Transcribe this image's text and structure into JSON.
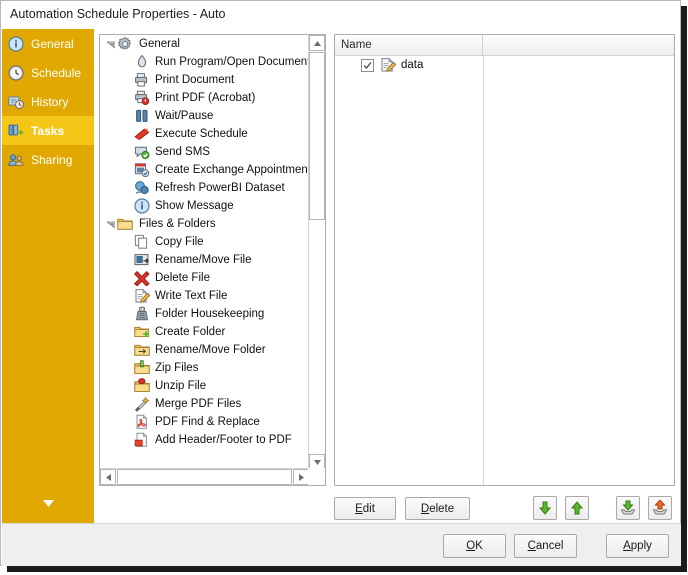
{
  "window": {
    "title": "Automation Schedule Properties - Auto"
  },
  "sidebar": {
    "items": [
      {
        "label": "General",
        "icon": "info-icon",
        "selected": false
      },
      {
        "label": "Schedule",
        "icon": "clock-icon",
        "selected": false
      },
      {
        "label": "History",
        "icon": "history-icon",
        "selected": false
      },
      {
        "label": "Tasks",
        "icon": "tasks-icon",
        "selected": true
      },
      {
        "label": "Sharing",
        "icon": "sharing-icon",
        "selected": false
      }
    ],
    "chevron_icon": "chevron-down-icon"
  },
  "tree": {
    "groups": [
      {
        "label": "General",
        "icon": "gear-icon",
        "expanded": true,
        "items": [
          {
            "label": "Run Program/Open Document",
            "icon": "run-program-icon"
          },
          {
            "label": "Print Document",
            "icon": "printer-icon"
          },
          {
            "label": "Print PDF (Acrobat)",
            "icon": "print-pdf-icon"
          },
          {
            "label": "Wait/Pause",
            "icon": "pause-icon"
          },
          {
            "label": "Execute Schedule",
            "icon": "execute-schedule-icon"
          },
          {
            "label": "Send SMS",
            "icon": "send-sms-icon"
          },
          {
            "label": "Create Exchange Appointment",
            "icon": "calendar-icon"
          },
          {
            "label": "Refresh PowerBI Dataset",
            "icon": "powerbi-icon"
          },
          {
            "label": "Show Message",
            "icon": "info-icon"
          }
        ]
      },
      {
        "label": "Files & Folders",
        "icon": "folder-icon",
        "expanded": true,
        "items": [
          {
            "label": "Copy File",
            "icon": "copy-file-icon"
          },
          {
            "label": "Rename/Move File",
            "icon": "rename-file-icon"
          },
          {
            "label": "Delete File",
            "icon": "delete-icon"
          },
          {
            "label": "Write Text File",
            "icon": "write-text-icon"
          },
          {
            "label": "Folder Housekeeping",
            "icon": "housekeeping-icon"
          },
          {
            "label": "Create Folder",
            "icon": "create-folder-icon"
          },
          {
            "label": "Rename/Move Folder",
            "icon": "rename-folder-icon"
          },
          {
            "label": "Zip Files",
            "icon": "zip-icon"
          },
          {
            "label": "Unzip File",
            "icon": "unzip-icon"
          },
          {
            "label": "Merge PDF Files",
            "icon": "merge-pdf-icon"
          },
          {
            "label": "PDF Find & Replace",
            "icon": "pdf-icon"
          },
          {
            "label": "Add Header/Footer to PDF",
            "icon": "pdf-header-icon"
          }
        ]
      }
    ]
  },
  "list": {
    "columns": [
      "Name",
      ""
    ],
    "rows": [
      {
        "name": "data",
        "checked": true,
        "icon": "write-text-icon"
      }
    ]
  },
  "actions": {
    "edit_label": "Edit",
    "edit_mnemonic": "E",
    "delete_label": "Delete",
    "delete_mnemonic": "D",
    "move_down_icon": "arrow-down-icon",
    "move_up_icon": "arrow-up-icon",
    "import_icon": "import-icon",
    "export_icon": "export-icon"
  },
  "footer": {
    "ok_label": "OK",
    "ok_mnemonic": "O",
    "cancel_label": "Cancel",
    "cancel_mnemonic": "C",
    "apply_label": "Apply",
    "apply_mnemonic": "A"
  },
  "colors": {
    "sidebar": "#e0a800",
    "sidebar_selected": "#f5c518",
    "footer": "#efefef",
    "accent_green": "#4aa72a",
    "accent_orange": "#e06a1b"
  }
}
